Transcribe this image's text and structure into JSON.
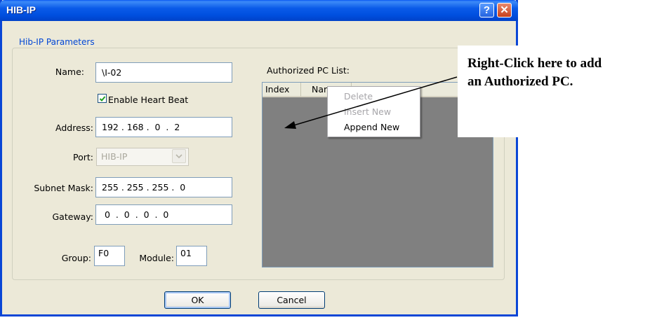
{
  "window": {
    "title": "HIB-IP",
    "help_glyph": "?",
    "close_glyph": "✕"
  },
  "params": {
    "group_title": "Hib-IP Parameters",
    "name_label": "Name:",
    "name_value": "\\I-02",
    "heartbeat_label": "Enable Heart Beat",
    "heartbeat_checked": true,
    "address_label": "Address:",
    "address_value": "192 . 168 .  0  .  2",
    "port_label": "Port:",
    "port_value": "HIB-IP",
    "subnet_label": "Subnet Mask:",
    "subnet_value": "255 . 255 . 255 .  0",
    "gateway_label": "Gateway:",
    "gateway_value": " 0  .  0  .  0  .  0",
    "group_label": "Group:",
    "group_value": "F0",
    "module_label": "Module:",
    "module_value": "01"
  },
  "pclist": {
    "title": "Authorized PC List:",
    "columns": [
      "Index",
      "Nar"
    ]
  },
  "context_menu": {
    "items": [
      {
        "label": "Delete",
        "enabled": false
      },
      {
        "label": "Insert New",
        "enabled": false
      },
      {
        "label": "Append New",
        "enabled": true
      }
    ]
  },
  "callout": {
    "line1": "Right-Click here to add",
    "line2": "an Authorized PC."
  },
  "buttons": {
    "ok": "OK",
    "cancel": "Cancel"
  },
  "colors": {
    "titlebar": "#0050e0",
    "group_title": "#0046d5",
    "list_background": "#808080",
    "dialog_background": "#ece9d8"
  }
}
